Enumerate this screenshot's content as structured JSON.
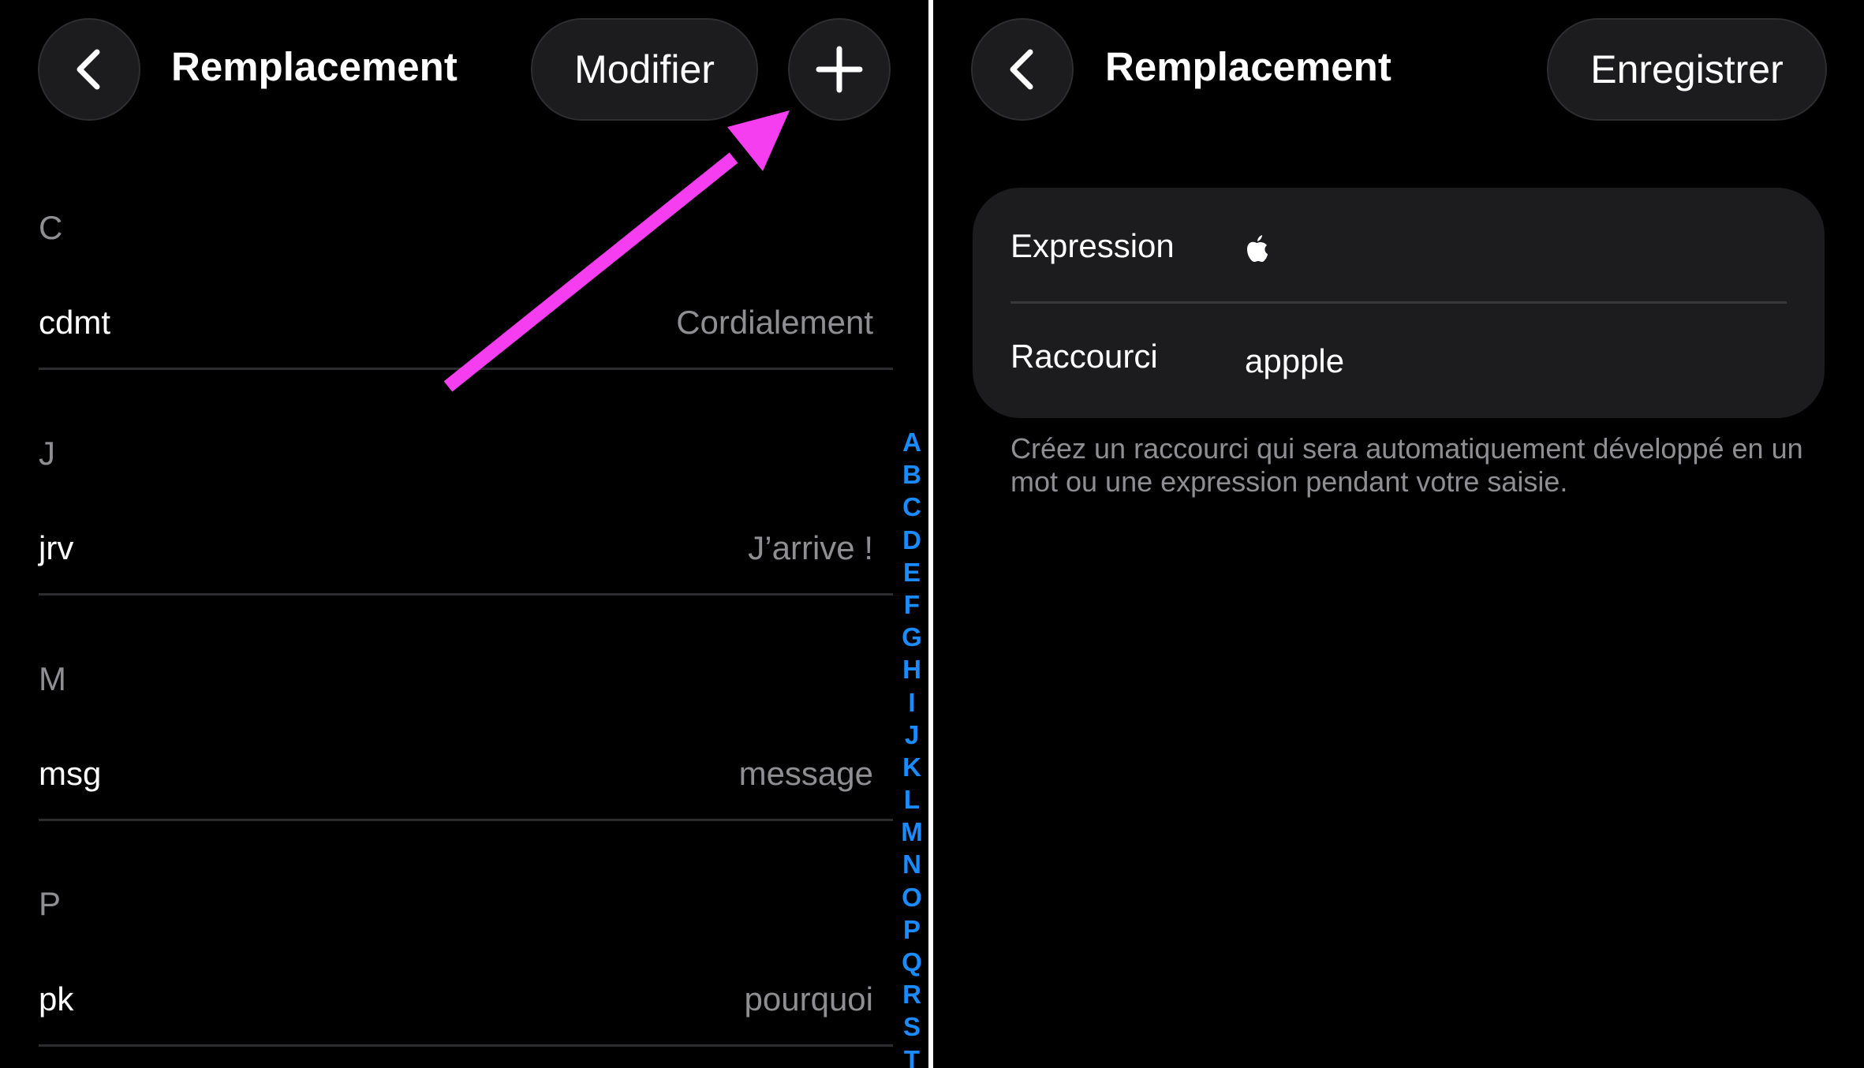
{
  "left": {
    "nav": {
      "back_icon": "chevron-left-icon",
      "title": "Remplacement",
      "edit_label": "Modifier",
      "add_icon": "plus-icon"
    },
    "sections": [
      {
        "letter": "C",
        "entries": [
          {
            "shortcut": "cdmt",
            "phrase": "Cordialement"
          }
        ]
      },
      {
        "letter": "J",
        "entries": [
          {
            "shortcut": "jrv",
            "phrase": "J’arrive !"
          }
        ]
      },
      {
        "letter": "M",
        "entries": [
          {
            "shortcut": "msg",
            "phrase": "message"
          }
        ]
      },
      {
        "letter": "P",
        "entries": [
          {
            "shortcut": "pk",
            "phrase": "pourquoi"
          }
        ]
      }
    ],
    "index_letters": [
      "A",
      "B",
      "C",
      "D",
      "E",
      "F",
      "G",
      "H",
      "I",
      "J",
      "K",
      "L",
      "M",
      "N",
      "O",
      "P",
      "Q",
      "R",
      "S",
      "T"
    ],
    "annotation": {
      "icon": "arrow-annotation-icon",
      "color": "#f43ef0"
    }
  },
  "right": {
    "nav": {
      "back_icon": "chevron-left-icon",
      "title": "Remplacement",
      "save_label": "Enregistrer"
    },
    "form": {
      "expression_label": "Expression",
      "expression_value_icon": "apple-logo-icon",
      "shortcut_label": "Raccourci",
      "shortcut_value": "appple"
    },
    "footer_note": "Créez un raccourci qui sera automatiquement développé en un mot ou une expression pendant votre saisie."
  },
  "colors": {
    "background": "#000000",
    "surface": "#1c1c1e",
    "secondary_text": "#8e8e93",
    "index_blue": "#1a8cff"
  }
}
